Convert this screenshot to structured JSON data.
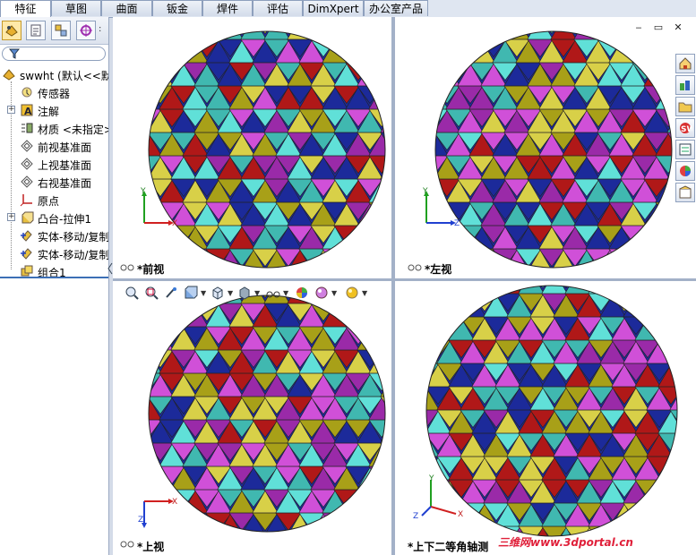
{
  "tabs": [
    {
      "label": "特征",
      "active": true
    },
    {
      "label": "草图",
      "active": false
    },
    {
      "label": "曲面",
      "active": false
    },
    {
      "label": "钣金",
      "active": false
    },
    {
      "label": "焊件",
      "active": false
    },
    {
      "label": "评估",
      "active": false
    },
    {
      "label": "DimXpert",
      "active": false
    },
    {
      "label": "办公室产品",
      "active": false
    }
  ],
  "tree": {
    "root": "swwht  (默认<<默",
    "items": [
      {
        "label": "传感器",
        "icon": "sensor-icon"
      },
      {
        "label": "注解",
        "icon": "annotation-icon"
      },
      {
        "label": "材质 <未指定>",
        "icon": "material-icon"
      },
      {
        "label": "前视基准面",
        "icon": "plane-icon"
      },
      {
        "label": "上视基准面",
        "icon": "plane-icon"
      },
      {
        "label": "右视基准面",
        "icon": "plane-icon"
      },
      {
        "label": "原点",
        "icon": "origin-icon"
      },
      {
        "label": "凸台-拉伸1",
        "icon": "extrude-icon"
      },
      {
        "label": "实体-移动/复制",
        "icon": "move-copy-icon"
      },
      {
        "label": "实体-移动/复制",
        "icon": "move-copy-icon"
      },
      {
        "label": "组合1",
        "icon": "combine-icon"
      }
    ]
  },
  "viewports": [
    {
      "label": "*前视",
      "axes": {
        "h": "X",
        "v": "Y"
      }
    },
    {
      "label": "*左视",
      "axes": {
        "h": "Z",
        "v": "Y"
      }
    },
    {
      "label": "*上视",
      "axes": {
        "h": "X",
        "v": "Z"
      }
    },
    {
      "label": "*上下二等角轴测",
      "axes": {
        "h": "X",
        "v": "Y",
        "d": "Z"
      }
    }
  ],
  "watermark": "三维网www.3dportal.cn",
  "colors": {
    "red": "#b01818",
    "purple": "#9a2aa8",
    "magenta": "#d050d8",
    "olive": "#a8a018",
    "yellow": "#d8d048",
    "navy": "#1c2a9a",
    "teal": "#40b8b0",
    "cyan": "#60e0d8"
  }
}
